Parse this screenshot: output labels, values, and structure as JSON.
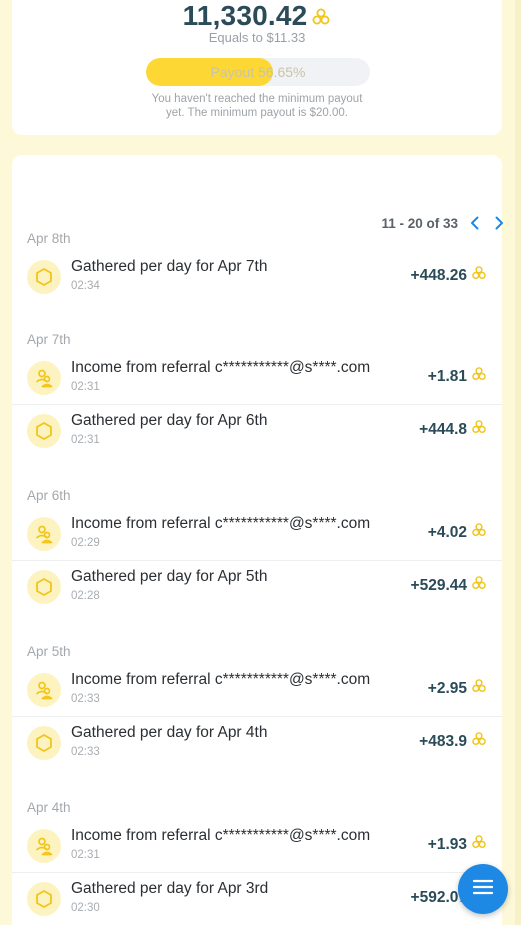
{
  "balance": {
    "amount": "11,330.42",
    "equals": "Equals to $11.33",
    "payout_label": "Payout 56.65%",
    "payout_progress": 0.5665,
    "note_line1": "You haven't reached the minimum payout",
    "note_line2": "yet. The minimum payout is $20.00."
  },
  "pagination": {
    "text": "11 - 20 of 33",
    "prev_icon": "chevron-left-icon",
    "next_icon": "chevron-right-icon"
  },
  "groups": [
    {
      "date": "Apr 8th",
      "items": [
        {
          "type": "gathered",
          "icon": "hexagon-icon",
          "title": "Gathered per day for Apr 7th",
          "time": "02:34",
          "amount": "+448.26"
        }
      ]
    },
    {
      "date": "Apr 7th",
      "items": [
        {
          "type": "referral",
          "icon": "referral-users-icon",
          "title": "Income from referral c***********@s****.com",
          "time": "02:31",
          "amount": "+1.81"
        },
        {
          "type": "gathered",
          "icon": "hexagon-icon",
          "title": "Gathered per day for Apr 6th",
          "time": "02:31",
          "amount": "+444.8"
        }
      ]
    },
    {
      "date": "Apr 6th",
      "items": [
        {
          "type": "referral",
          "icon": "referral-users-icon",
          "title": "Income from referral c***********@s****.com",
          "time": "02:29",
          "amount": "+4.02"
        },
        {
          "type": "gathered",
          "icon": "hexagon-icon",
          "title": "Gathered per day for Apr 5th",
          "time": "02:28",
          "amount": "+529.44"
        }
      ]
    },
    {
      "date": "Apr 5th",
      "items": [
        {
          "type": "referral",
          "icon": "referral-users-icon",
          "title": "Income from referral c***********@s****.com",
          "time": "02:33",
          "amount": "+2.95"
        },
        {
          "type": "gathered",
          "icon": "hexagon-icon",
          "title": "Gathered per day for Apr 4th",
          "time": "02:33",
          "amount": "+483.9"
        }
      ]
    },
    {
      "date": "Apr 4th",
      "items": [
        {
          "type": "referral",
          "icon": "referral-users-icon",
          "title": "Income from referral c***********@s****.com",
          "time": "02:31",
          "amount": "+1.93"
        },
        {
          "type": "gathered",
          "icon": "hexagon-icon",
          "title": "Gathered per day for Apr 3rd",
          "time": "02:30",
          "amount": "+592.07"
        }
      ]
    }
  ],
  "fab": {
    "icon": "menu-icon"
  },
  "colors": {
    "accent_yellow": "#fdd835",
    "coin_yellow": "#f2c51b",
    "dark_teal": "#2a4b57",
    "fab_blue": "#1e88e5"
  }
}
